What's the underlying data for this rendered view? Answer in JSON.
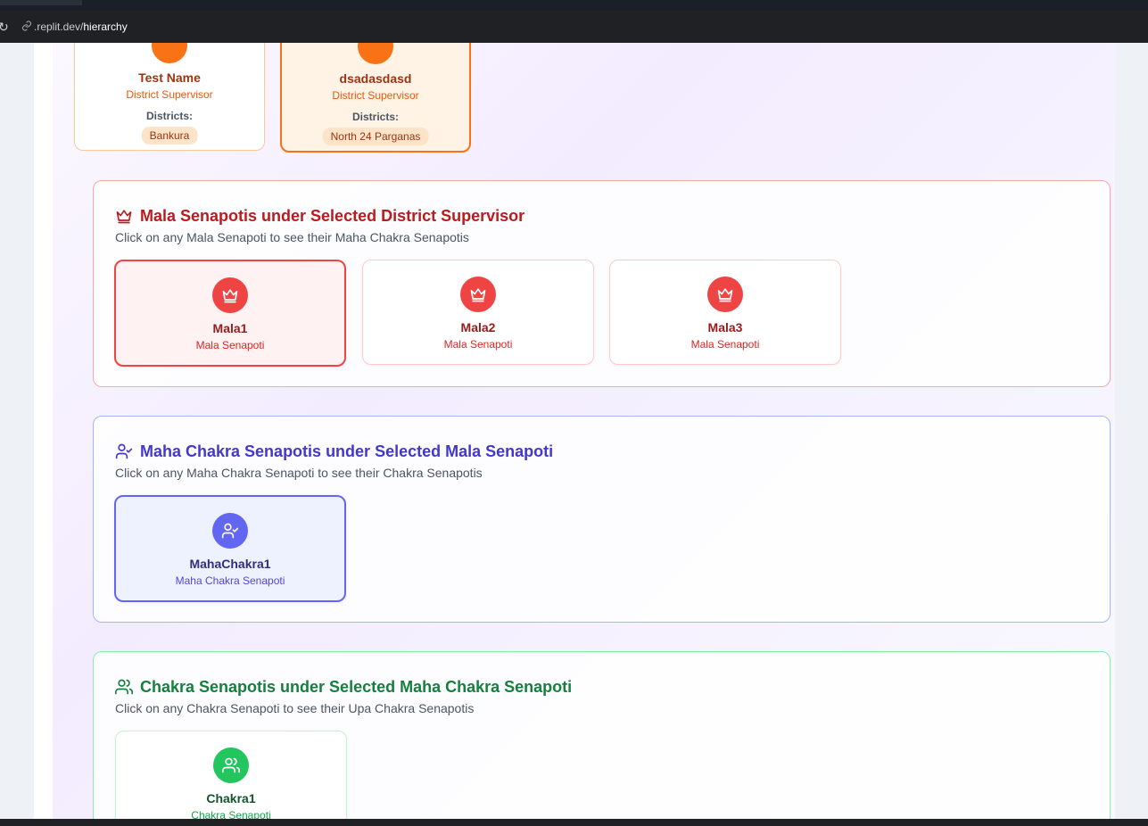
{
  "browser": {
    "url_host": ".replit.dev/",
    "url_path": "hierarchy"
  },
  "district_supervisors": [
    {
      "name": "Test Name",
      "role": "District Supervisor",
      "districts_label": "Districts:",
      "districts": [
        "Bankura"
      ],
      "selected": false
    },
    {
      "name": "dsadasdasd",
      "role": "District Supervisor",
      "districts_label": "Districts:",
      "districts": [
        "North 24 Parganas"
      ],
      "selected": true
    }
  ],
  "mala_section": {
    "title": "Mala Senapotis under Selected District Supervisor",
    "description": "Click on any Mala Senapoti to see their Maha Chakra Senapotis",
    "icon": "crown-icon",
    "color": "#b91c1c",
    "items": [
      {
        "name": "Mala1",
        "role": "Mala Senapoti",
        "selected": true
      },
      {
        "name": "Mala2",
        "role": "Mala Senapoti",
        "selected": false
      },
      {
        "name": "Mala3",
        "role": "Mala Senapoti",
        "selected": false
      }
    ]
  },
  "maha_section": {
    "title": "Maha Chakra Senapotis under Selected Mala Senapoti",
    "description": "Click on any Maha Chakra Senapoti to see their Chakra Senapotis",
    "icon": "user-check-icon",
    "color": "#4338ca",
    "items": [
      {
        "name": "MahaChakra1",
        "role": "Maha Chakra Senapoti",
        "selected": true
      }
    ]
  },
  "chakra_section": {
    "title": "Chakra Senapotis under Selected Maha Chakra Senapoti",
    "description": "Click on any Chakra Senapoti to see their Upa Chakra Senapotis",
    "icon": "users-icon",
    "color": "#15803d",
    "items": [
      {
        "name": "Chakra1",
        "role": "Chakra Senapoti",
        "selected": false
      }
    ]
  }
}
